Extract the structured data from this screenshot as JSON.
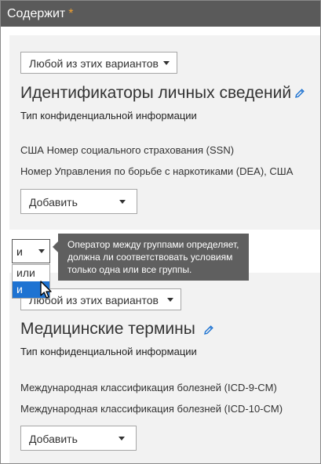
{
  "header": {
    "title": "Содержит",
    "required_mark": "*"
  },
  "groups": [
    {
      "match_mode": "Любой из этих вариантов",
      "title": "Идентификаторы личных сведений",
      "subheading": "Тип конфиденциальной информации",
      "items": [
        "США Номер социального страхования (SSN)",
        "Номер Управления по борьбе с наркотиками (DEA), США"
      ],
      "add_label": "Добавить"
    },
    {
      "match_mode": "Любой из этих вариантов",
      "title": "Медицинские термины",
      "subheading": "Тип конфиденциальной информации",
      "items": [
        "Международная классификация болезней (ICD-9-CM)",
        "Международная классификация болезней (ICD-10-CM)"
      ],
      "add_label": "Добавить"
    }
  ],
  "operator": {
    "selected": "и",
    "options": [
      "или",
      "и"
    ],
    "tooltip_lines": [
      "Оператор между группами определяет,",
      "должна ли соответствовать условиям",
      "только одна или все группы."
    ]
  },
  "colors": {
    "header_bg": "#5a5a5a",
    "required": "#f0a030",
    "selection": "#1e73d2",
    "link_icon": "#1e73d2"
  },
  "icons": {
    "edit": "pencil-icon",
    "dropdown": "chevron-down-icon",
    "cursor": "mouse-pointer-icon"
  }
}
